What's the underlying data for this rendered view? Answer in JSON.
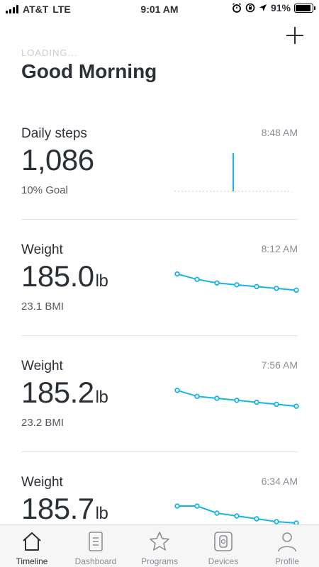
{
  "status_bar": {
    "carrier": "AT&T",
    "network": "LTE",
    "time": "9:01 AM",
    "battery_percent": "91%",
    "battery_level": 0.91
  },
  "header": {
    "loading_text": "LOADING...",
    "greeting": "Good Morning"
  },
  "cards": [
    {
      "title": "Daily steps",
      "time": "8:48 AM",
      "value": "1,086",
      "unit": "",
      "sub": "10% Goal",
      "spark": [
        0.09,
        0.1,
        0.08,
        1.0,
        0.05,
        0.06,
        0.07
      ]
    },
    {
      "title": "Weight",
      "time": "8:12 AM",
      "value": "185.0",
      "unit": "lb",
      "sub": "23.1 BMI",
      "spark": [
        185.9,
        185.6,
        185.4,
        185.3,
        185.2,
        185.1,
        185.0
      ]
    },
    {
      "title": "Weight",
      "time": "7:56 AM",
      "value": "185.2",
      "unit": "lb",
      "sub": "23.2 BMI",
      "spark": [
        186.0,
        185.7,
        185.6,
        185.5,
        185.4,
        185.3,
        185.2
      ]
    },
    {
      "title": "Weight",
      "time": "6:34 AM",
      "value": "185.7",
      "unit": "lb",
      "sub": "",
      "spark": [
        186.9,
        186.9,
        186.4,
        186.2,
        186.0,
        185.8,
        185.7
      ]
    }
  ],
  "tabs": [
    {
      "label": "Timeline",
      "icon": "home-icon",
      "active": true
    },
    {
      "label": "Dashboard",
      "icon": "dashboard-icon",
      "active": false
    },
    {
      "label": "Programs",
      "icon": "star-icon",
      "active": false
    },
    {
      "label": "Devices",
      "icon": "watch-icon",
      "active": false
    },
    {
      "label": "Profile",
      "icon": "person-icon",
      "active": false
    }
  ],
  "colors": {
    "accent": "#16b4e6",
    "text": "#2b2f36",
    "muted": "#8a8f96"
  }
}
